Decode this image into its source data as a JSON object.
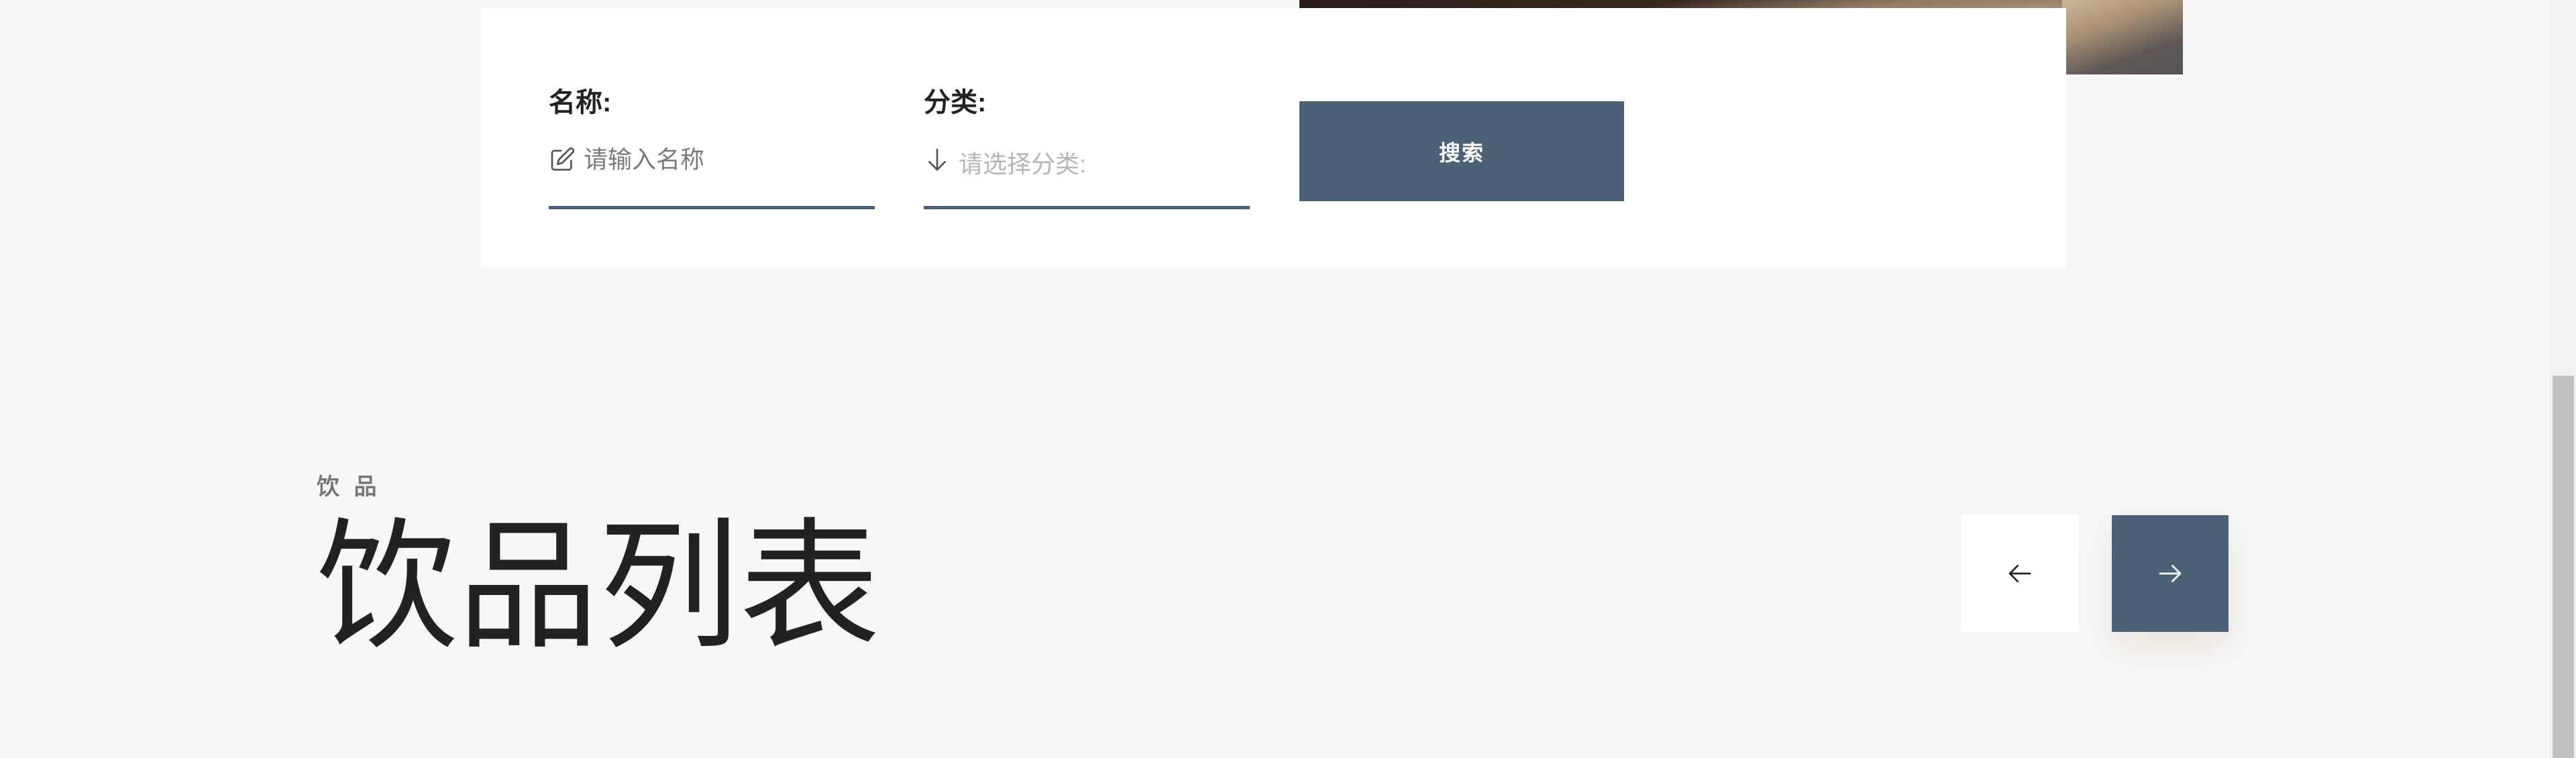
{
  "search": {
    "name_label": "名称:",
    "name_placeholder": "请输入名称",
    "category_label": "分类:",
    "category_placeholder": "请选择分类:",
    "search_button": "搜索"
  },
  "section": {
    "eyebrow": "饮 品",
    "title": "饮品列表"
  },
  "icons": {
    "name_field": "edit-icon",
    "category_field": "arrow-down-icon",
    "prev": "arrow-left-icon",
    "next": "arrow-right-icon"
  },
  "colors": {
    "accent": "#4c6176",
    "background": "#f7f7f7",
    "panel": "#ffffff"
  }
}
